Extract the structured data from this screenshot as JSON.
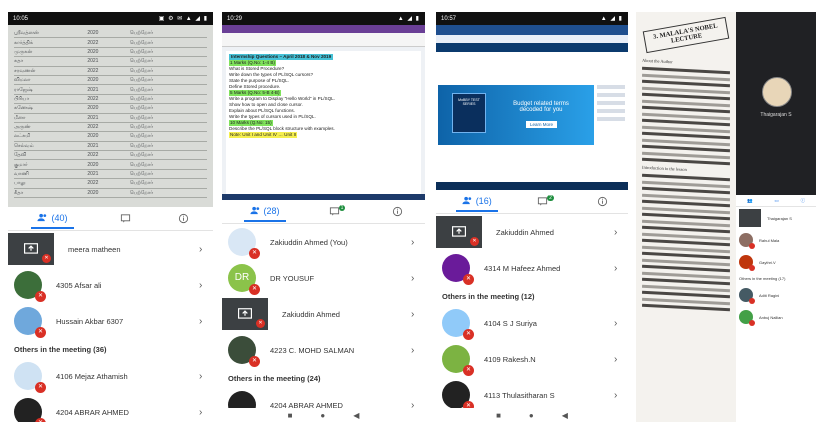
{
  "panel1": {
    "status_time": "10:05",
    "status_icons": "▣ ⚙ ✉   ▲ ◢ ▮",
    "table_rows": [
      [
        "ஸ்ரீவத்ஸன்",
        "2020",
        "பெற்றோர்"
      ],
      [
        "கார்த்திக்",
        "2022",
        "பெற்றோர்"
      ],
      [
        "முருகன்",
        "2020",
        "பெற்றோர்"
      ],
      [
        "சுதா",
        "2021",
        "பெற்றோர்"
      ],
      [
        "சரவணன்",
        "2022",
        "பெற்றோர்"
      ],
      [
        "விமலா",
        "2020",
        "பெற்றோர்"
      ],
      [
        "ராஜேஷ்",
        "2021",
        "பெற்றோர்"
      ],
      [
        "பிரியா",
        "2022",
        "பெற்றோர்"
      ],
      [
        "கணேஷ்",
        "2020",
        "பெற்றோர்"
      ],
      [
        "மீனா",
        "2021",
        "பெற்றோர்"
      ],
      [
        "அருண்",
        "2022",
        "பெற்றோர்"
      ],
      [
        "லட்சுமி",
        "2020",
        "பெற்றோர்"
      ],
      [
        "செல்வம்",
        "2021",
        "பெற்றோர்"
      ],
      [
        "தேவி",
        "2022",
        "பெற்றோர்"
      ],
      [
        "குமார்",
        "2020",
        "பெற்றோர்"
      ],
      [
        "வாணி",
        "2021",
        "பெற்றோர்"
      ],
      [
        "பாலு",
        "2022",
        "பெற்றோர்"
      ],
      [
        "கீதா",
        "2020",
        "பெற்றோர்"
      ]
    ],
    "people_count": "(40)",
    "participants": [
      {
        "name": "meera matheen",
        "type": "screen"
      },
      {
        "name": "4305 Afsar ali",
        "type": "avatar",
        "color": "#3c6e3a"
      },
      {
        "name": "Hussain Akbar 6307",
        "type": "avatar",
        "color": "#6fa8dc"
      }
    ],
    "others_label": "Others in the meeting (36)",
    "others": [
      {
        "name": "4106 Mejaz Athamish",
        "color": "#cfe2f3"
      },
      {
        "name": "4204 ABRAR AHMED",
        "color": "#222222"
      }
    ]
  },
  "panel2": {
    "status_time": "10:29",
    "status_icons": "▲ ◢ ▮",
    "doc_title": "Intermship Questions – April 2018 & Nov 2019",
    "doc_lines": [
      {
        "text": "1 Marks (Q.No: 1-4 B)",
        "hl": "green"
      },
      {
        "text": "What is Stored Procedure?",
        "hl": ""
      },
      {
        "text": "Write down the types of PL/SQL cursors?",
        "hl": ""
      },
      {
        "text": "State the purpose of PL/SQL.",
        "hl": ""
      },
      {
        "text": "Define Stored procedure.",
        "hl": ""
      },
      {
        "text": "5 Marks (Q.No: 5-B 4-B)",
        "hl": "green"
      },
      {
        "text": "Write a program to Display \"Hello World\" in PL/SQL.",
        "hl": ""
      },
      {
        "text": "Show how to open and close cursor.",
        "hl": ""
      },
      {
        "text": "Explain about PL/SQL functions.",
        "hl": ""
      },
      {
        "text": "Write the types of cursors used in PL/SQL.",
        "hl": ""
      },
      {
        "text": "10 Marks (Q.No: 15)",
        "hl": "green"
      },
      {
        "text": "Describe the PL/SQL block structure with examples.",
        "hl": ""
      },
      {
        "text": "Note: Unit I and Unit IV … Unit II",
        "hl": "yellow"
      }
    ],
    "people_count": "(28)",
    "chat_badge": "1",
    "participants": [
      {
        "name": "Zakiuddin Ahmed (You)",
        "type": "avatar",
        "color": "#d9e7f5",
        "speaking": true
      },
      {
        "name": "DR YOUSUF",
        "type": "initials",
        "initials": "DR",
        "color": "#8bc34a"
      },
      {
        "name": "Zakiuddin Ahmed",
        "type": "screen"
      },
      {
        "name": "4223 C. MOHD SALMAN",
        "type": "avatar",
        "color": "#3b4d3a"
      }
    ],
    "others_label": "Others in the meeting (24)",
    "others": [
      {
        "name": "4204 ABRAR AHMED",
        "color": "#222222"
      }
    ]
  },
  "panel3": {
    "status_time": "10:57",
    "status_icons": "▲ ◢ ▮",
    "book_text": "MoBBY TEST SERIES",
    "banner_text": "Budget related terms decoded for you",
    "banner_button": "Learn More",
    "people_count": "(16)",
    "chat_badge": "2",
    "participants": [
      {
        "name": "Zakiuddin Ahmed",
        "type": "screen"
      },
      {
        "name": "4314 M Hafeez Ahmed",
        "type": "avatar",
        "color": "#6a1b9a"
      }
    ],
    "others_label": "Others in the meeting (12)",
    "others": [
      {
        "name": "4104 S J Suriya",
        "color": "#90caf9"
      },
      {
        "name": "4109 Rakesh.N",
        "color": "#7cb342"
      },
      {
        "name": "4113 Thulasitharan S",
        "color": "#222222"
      }
    ]
  },
  "panel4": {
    "page_title": "3. MALALA'S NOBEL LECTURE",
    "about_label": "About the Author",
    "intro_label": "Introduction to the lesson",
    "presenter_name": "Thaigarajan S",
    "mini_people": [
      {
        "name": "Thaigarajan S",
        "color": "#3c4043"
      },
      {
        "name": "Rahul Mala",
        "color": "#8d6e63"
      },
      {
        "name": "Gaythri.V",
        "color": "#bf360c"
      }
    ],
    "mini_others_label": "Others in the meeting (17)",
    "mini_others": [
      {
        "name": "Aditi Ragini",
        "color": "#455a64"
      },
      {
        "name": "Anbuj Nallian",
        "color": "#43a047"
      }
    ]
  },
  "colors": {
    "accent": "#1a73e8",
    "mute_red": "#d93025",
    "tile_dark": "#3c4043"
  }
}
